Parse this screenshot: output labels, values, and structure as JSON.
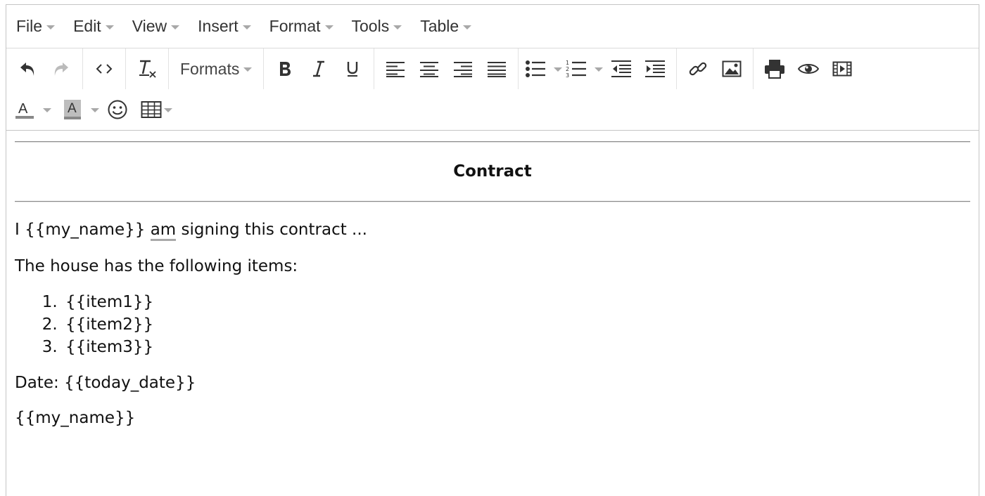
{
  "menubar": {
    "items": [
      "File",
      "Edit",
      "View",
      "Insert",
      "Format",
      "Tools",
      "Table"
    ]
  },
  "toolbar": {
    "formats_label": "Formats",
    "icons": [
      "undo-icon",
      "redo-icon",
      "source-code-icon",
      "clear-format-icon",
      "bold-icon",
      "italic-icon",
      "underline-icon",
      "align-left-icon",
      "align-center-icon",
      "align-right-icon",
      "justify-icon",
      "bullet-list-icon",
      "numbered-list-icon",
      "outdent-icon",
      "indent-icon",
      "link-icon",
      "image-icon",
      "print-icon",
      "preview-icon",
      "media-icon",
      "text-color-icon",
      "background-color-icon",
      "emoticons-icon",
      "table-icon"
    ],
    "text_color_glyph": "A",
    "bg_color_glyph": "A"
  },
  "document": {
    "title": "Contract",
    "p1_before": "I {{my_name}} ",
    "p1_misspelled": "am",
    "p1_after": " signing this contract ...",
    "p2": "The house has the following items:",
    "list": [
      "{{item1}}",
      "{{item2}}",
      "{{item3}}"
    ],
    "p3": "Date: {{today_date}}",
    "p4": "{{my_name}}"
  },
  "colors": {
    "icon": "#333333",
    "disabled_icon": "#bbbbbb",
    "text_color_bar": "#888888",
    "bg_color_fill": "#bdbdbd"
  }
}
